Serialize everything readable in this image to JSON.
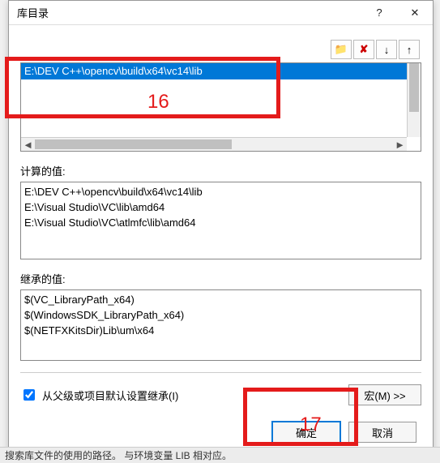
{
  "dialog": {
    "title": "库目录",
    "help_glyph": "?",
    "close_glyph": "✕"
  },
  "toolbar": {
    "new_folder_icon": "📁",
    "delete_glyph": "✘",
    "down_glyph": "↓",
    "up_glyph": "↑"
  },
  "edit_list": {
    "selected": "E:\\DEV C++\\opencv\\build\\x64\\vc14\\lib"
  },
  "computed": {
    "label": "计算的值:",
    "lines": [
      "E:\\DEV C++\\opencv\\build\\x64\\vc14\\lib",
      "E:\\Visual Studio\\VC\\lib\\amd64",
      "E:\\Visual Studio\\VC\\atlmfc\\lib\\amd64"
    ]
  },
  "inherited": {
    "label": "继承的值:",
    "lines": [
      "$(VC_LibraryPath_x64)",
      "$(WindowsSDK_LibraryPath_x64)",
      "$(NETFXKitsDir)Lib\\um\\x64"
    ]
  },
  "inherit_checkbox": {
    "label": "从父级或项目默认设置继承(I)",
    "checked": true
  },
  "buttons": {
    "macro": "宏(M) >>",
    "ok": "确定",
    "cancel": "取消"
  },
  "annotations": {
    "a16": "16",
    "a17": "17"
  },
  "footer": "搜索库文件的使用的路径。  与环境变量 LIB 相对应。"
}
